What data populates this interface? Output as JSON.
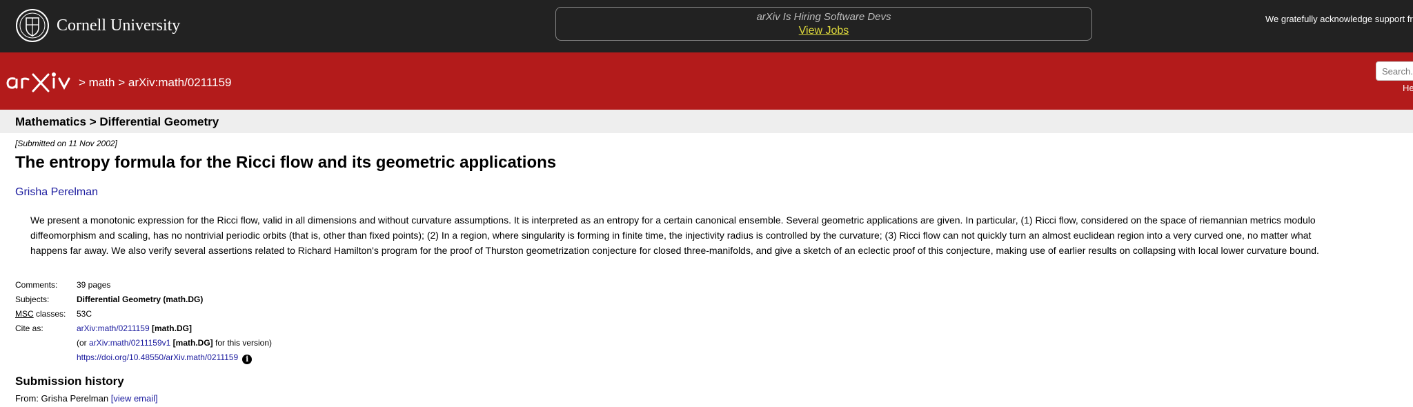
{
  "header": {
    "university": "Cornell University",
    "hiring_message": "arXiv Is Hiring Software Devs",
    "hiring_link": "View Jobs",
    "support_text": "We gratefully acknowledge support fr"
  },
  "nav": {
    "breadcrumb_sep": ">",
    "breadcrumb_category": "math",
    "breadcrumb_id": "arXiv:math/0211159",
    "search_placeholder": "Search...",
    "help_label": "He"
  },
  "subject_bar": {
    "text": "Mathematics > Differential Geometry"
  },
  "paper": {
    "submitted": "[Submitted on 11 Nov 2002]",
    "title": "The entropy formula for the Ricci flow and its geometric applications",
    "author": "Grisha Perelman",
    "abstract_lines": [
      "We present a monotonic expression for the Ricci flow, valid in all dimensions and without curvature assumptions. It is interpreted as an entropy for a certain canonical ensemble. Several geometric applications are given. In particular, (1) Ricci flow, considered on the space of riemannian metrics modulo",
      "diffeomorphism and scaling, has no nontrivial periodic orbits (that is, other than fixed points); (2) In a region, where singularity is forming in finite time, the injectivity radius is controlled by the curvature; (3) Ricci flow can not quickly turn an almost euclidean region into a very curved one, no matter what",
      "happens far away. We also verify several assertions related to Richard Hamilton's program for the proof of Thurston geometrization conjecture for closed three-manifolds, and give a sketch of an eclectic proof of this conjecture, making use of earlier results on collapsing with local lower curvature bound."
    ]
  },
  "metadata": {
    "comments_label": "Comments:",
    "comments_value": "39 pages",
    "subjects_label": "Subjects:",
    "subjects_value": "Differential Geometry (math.DG)",
    "msc_label_abbr": "MSC",
    "msc_label_rest": "classes:",
    "msc_value": "53C",
    "cite_label": "Cite as:",
    "cite_id": "arXiv:math/0211159",
    "cite_category": "[math.DG]",
    "cite_version_prefix": "(or",
    "cite_version_id": "arXiv:math/0211159v1",
    "cite_version_category": "[math.DG]",
    "cite_version_suffix": "for this version)",
    "doi": "https://doi.org/10.48550/arXiv.math/0211159",
    "info_glyph": "i"
  },
  "history": {
    "title": "Submission history",
    "from_label": "From: Grisha Perelman",
    "view_email": "[view email]"
  },
  "colors": {
    "top_bar": "#222222",
    "arxiv_red": "#b31b1b",
    "subject_bar": "#eeeeee",
    "link": "#1a1a9e",
    "jobs_link": "#e0db3c"
  },
  "icons": {
    "seal": "cornell-seal-icon",
    "logo": "arxiv-logo-icon",
    "info": "info-icon"
  }
}
